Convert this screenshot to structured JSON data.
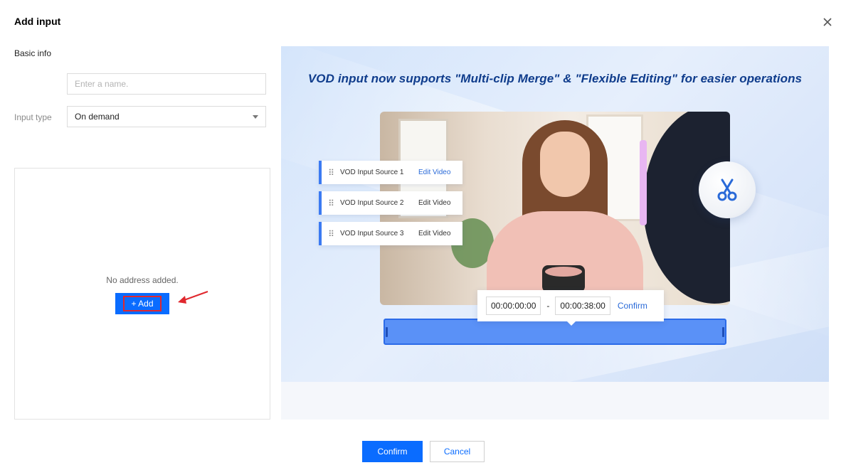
{
  "dialog": {
    "title": "Add input",
    "close_icon": "close-icon"
  },
  "form": {
    "section_label": "Basic info",
    "name_placeholder": "Enter a name.",
    "name_value": "",
    "input_type_label": "Input type",
    "input_type_value": "On demand"
  },
  "addresses": {
    "empty_text": "No address added.",
    "add_label": "+ Add"
  },
  "promo": {
    "headline": "VOD input now supports \"Multi-clip Merge\" & \"Flexible Editing\" for easier operations",
    "sources": [
      {
        "label": "VOD Input Source 1",
        "action": "Edit Video"
      },
      {
        "label": "VOD Input Source 2",
        "action": "Edit Video"
      },
      {
        "label": "VOD Input Source 3",
        "action": "Edit Video"
      }
    ],
    "clip_start": "00:00:00:00",
    "clip_separator": "-",
    "clip_end": "00:00:38:00",
    "clip_confirm": "Confirm"
  },
  "footer": {
    "confirm_label": "Confirm",
    "cancel_label": "Cancel"
  },
  "colors": {
    "primary": "#0a6cff",
    "highlight_red": "#e0282e",
    "headline": "#0f3c8c"
  }
}
